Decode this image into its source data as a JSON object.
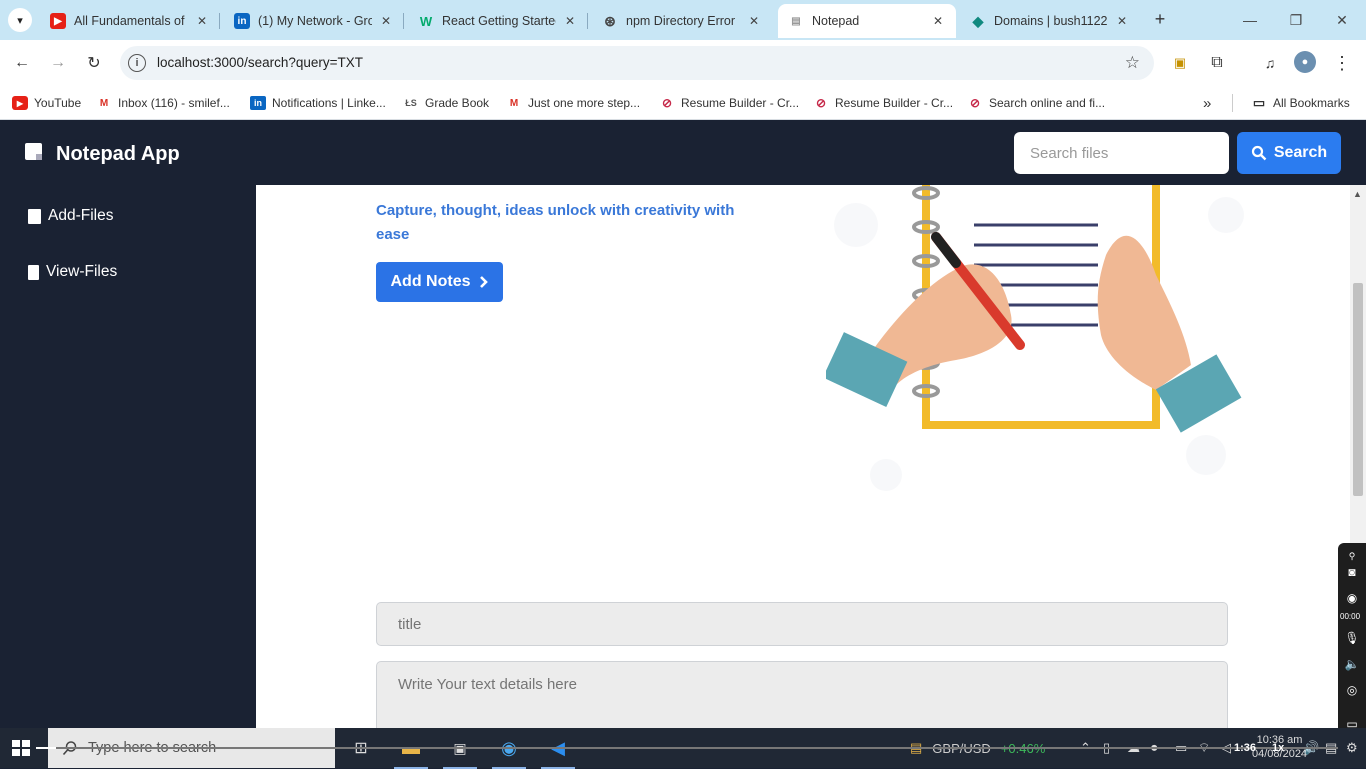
{
  "browser": {
    "tabs": [
      {
        "label": "All Fundamentals of J",
        "icon": "youtube-icon",
        "active": false
      },
      {
        "label": "(1) My Network - Gro",
        "icon": "linkedin-icon",
        "active": false
      },
      {
        "label": "React Getting Started",
        "icon": "w3schools-icon",
        "active": false
      },
      {
        "label": "npm Directory Error",
        "icon": "chatgpt-icon",
        "active": false
      },
      {
        "label": "Notepad",
        "icon": "react-favicon-icon",
        "active": true
      },
      {
        "label": "Domains | bush1122",
        "icon": "domain-icon",
        "active": false
      }
    ],
    "url": "localhost:3000/search?query=TXT",
    "bookmarks": [
      "YouTube",
      "Inbox (116) - smilef...",
      "Notifications | Linke...",
      "Grade Book",
      "Just one more step...",
      "Resume Builder - Cr...",
      "Resume Builder - Cr...",
      "Search online and fi..."
    ],
    "all_bookmarks": "All Bookmarks"
  },
  "app": {
    "brand": "Notepad App",
    "search_placeholder": "Search files",
    "search_button": "Search",
    "sidebar": [
      {
        "label": "Add-Files",
        "icon": "sticky-note-icon"
      },
      {
        "label": "View-Files",
        "icon": "file-icon"
      }
    ],
    "tagline": "Capture, thought, ideas unlock with creativity with ease",
    "add_notes_button": "Add Notes",
    "title_placeholder": "title",
    "details_placeholder": "Write Your text details here"
  },
  "recorder": {
    "time": "00:00"
  },
  "taskbar": {
    "search_placeholder": "Type here to search",
    "ticker_symbol": "GBP/USD",
    "ticker_change": "+0.46%",
    "time": "10:36 am",
    "date": "04/08/2024"
  },
  "video": {
    "elapsed": "1:36",
    "rate": "1x",
    "progress_fraction": 0.015
  },
  "colors": {
    "accent": "#2b7cf0",
    "navbar": "#1a2233",
    "tagline": "#3a78d8"
  }
}
